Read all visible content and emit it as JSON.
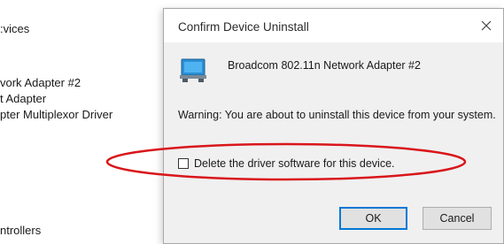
{
  "background": {
    "lines": [
      {
        "text": ":vices"
      },
      {
        "text": "vork Adapter #2"
      },
      {
        "text": "t Adapter"
      },
      {
        "text": "pter Multiplexor Driver"
      },
      {
        "text": "ntrollers"
      }
    ]
  },
  "dialog": {
    "title": "Confirm Device Uninstall",
    "close_icon": "close-icon",
    "device_icon": "network-adapter-icon",
    "device_name": "Broadcom 802.11n Network Adapter #2",
    "warning": "Warning: You are about to uninstall this device from your system.",
    "checkbox_label": "Delete the driver software for this device.",
    "checkbox_checked": false,
    "ok_label": "OK",
    "cancel_label": "Cancel"
  },
  "annotation": {
    "color": "#d9161b"
  }
}
